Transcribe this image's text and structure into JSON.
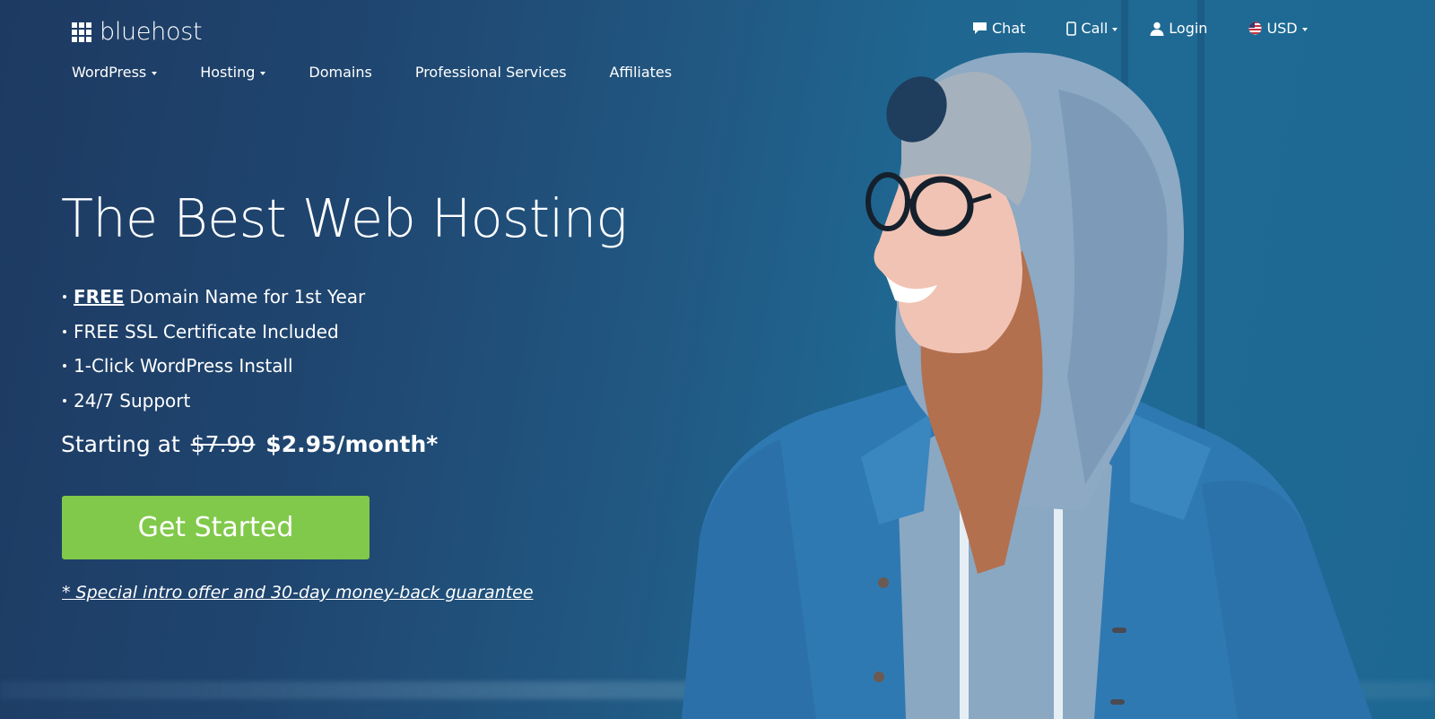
{
  "brand": {
    "name": "bluehost",
    "logo_icon": "grid-3x3-icon"
  },
  "utility_nav": {
    "chat": {
      "label": "Chat",
      "icon": "chat-bubble-icon"
    },
    "call": {
      "label": "Call",
      "icon": "phone-icon",
      "has_dropdown": true
    },
    "login": {
      "label": "Login",
      "icon": "user-icon"
    },
    "currency": {
      "label": "USD",
      "icon": "us-flag-icon",
      "has_dropdown": true
    }
  },
  "main_nav": [
    {
      "label": "WordPress",
      "has_dropdown": true
    },
    {
      "label": "Hosting",
      "has_dropdown": true
    },
    {
      "label": "Domains",
      "has_dropdown": false
    },
    {
      "label": "Professional Services",
      "has_dropdown": false
    },
    {
      "label": "Affiliates",
      "has_dropdown": false
    }
  ],
  "hero": {
    "headline": "The Best Web Hosting",
    "bullets": [
      {
        "emphasis": "FREE",
        "text": "Domain Name for 1st Year"
      },
      {
        "text": "FREE SSL Certificate Included"
      },
      {
        "text": "1-Click WordPress Install"
      },
      {
        "text": "24/7 Support"
      }
    ],
    "price": {
      "prefix": "Starting at",
      "old": "$7.99",
      "new": "$2.95/month*"
    },
    "cta_label": "Get Started",
    "disclaimer": "* Special intro offer and 30-day money-back guarantee"
  },
  "colors": {
    "cta_green": "#81c94a",
    "background_blue": "#1f4670",
    "text": "#ffffff"
  }
}
